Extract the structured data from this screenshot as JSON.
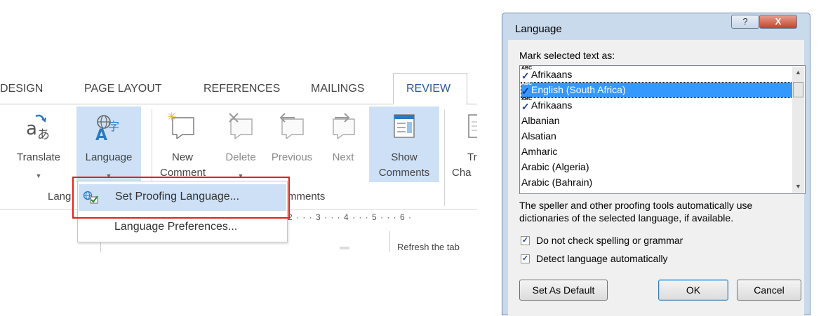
{
  "ribbon": {
    "tabs": [
      "DESIGN",
      "PAGE LAYOUT",
      "REFERENCES",
      "MAILINGS",
      "REVIEW"
    ],
    "active_tab": "REVIEW",
    "buttons": {
      "translate": "Translate",
      "language": "Language",
      "new_comment_1": "New",
      "new_comment_2": "Comment",
      "delete": "Delete",
      "previous": "Previous",
      "next": "Next",
      "show_comments_1": "Show",
      "show_comments_2": "Comments",
      "track_changes_1": "Tr",
      "track_changes_2": "Cha"
    },
    "groups": {
      "language_partial": "Lang",
      "comments_partial": "mments"
    },
    "ruler": "2 · · · 3 · · · 4 · · · 5 · · · 6 ·",
    "doc_text": "Refresh the tab"
  },
  "dropdown": {
    "items": [
      "Set Proofing Language...",
      "Language Preferences..."
    ]
  },
  "dialog": {
    "title": "Language",
    "help_glyph": "?",
    "close_glyph": "X",
    "mark_label": "Mark selected text as:",
    "languages": [
      {
        "name": "Afrikaans",
        "proofing": true,
        "selected": false
      },
      {
        "name": "English (South Africa)",
        "proofing": true,
        "selected": true
      },
      {
        "name": "Afrikaans",
        "proofing": true,
        "selected": false
      },
      {
        "name": "Albanian",
        "proofing": false,
        "selected": false
      },
      {
        "name": "Alsatian",
        "proofing": false,
        "selected": false
      },
      {
        "name": "Amharic",
        "proofing": false,
        "selected": false
      },
      {
        "name": "Arabic (Algeria)",
        "proofing": false,
        "selected": false
      },
      {
        "name": "Arabic (Bahrain)",
        "proofing": false,
        "selected": false
      }
    ],
    "description_1": "The speller and other proofing tools automatically use",
    "description_2": "dictionaries of the selected language, if available.",
    "checkbox_no_check": {
      "label": "Do not check spelling or grammar",
      "checked": true
    },
    "checkbox_detect": {
      "label": "Detect language automatically",
      "checked": true
    },
    "buttons": {
      "set_default": "Set As Default",
      "ok": "OK",
      "cancel": "Cancel"
    }
  },
  "colors": {
    "accent": "#2b579a",
    "highlight": "#cde0f5",
    "list_selection": "#3399ff",
    "callout": "#e02020"
  }
}
